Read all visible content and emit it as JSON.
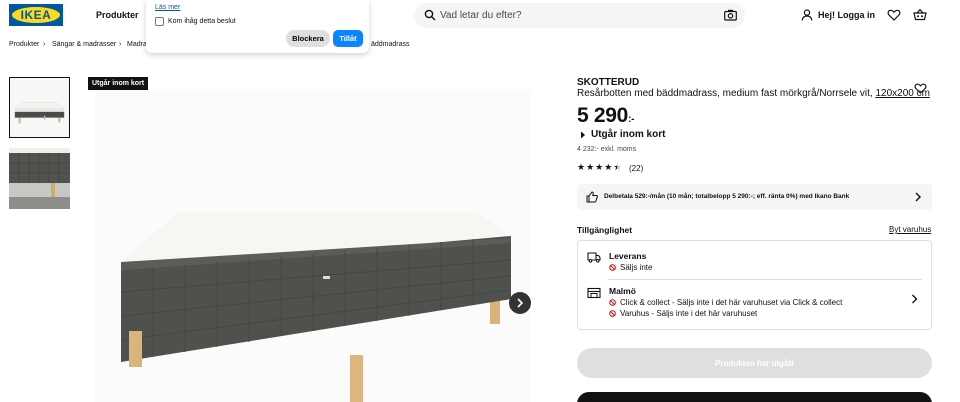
{
  "header": {
    "logo": "IKEA",
    "nav_products": "Produkter",
    "search_placeholder": "Vad letar du efter?",
    "login": "Hej! Logga in",
    "icons": [
      "search-icon",
      "camera-icon",
      "user-icon",
      "heart-icon",
      "cart-icon"
    ]
  },
  "cookie_popup": {
    "read_more": "Läs mer",
    "remember": "Kom ihåg detta beslut",
    "block": "Blockera",
    "allow": "Tillåt"
  },
  "breadcrumb": [
    "Produkter",
    "Sängar & madrasser",
    "Madra",
    "äddmadrass"
  ],
  "badge": "Utgår inom kort",
  "product": {
    "name": "SKOTTERUD",
    "description": "Resårbotten med bäddmadrass, medium fast mörkgrå/Norrsele vit, ",
    "size": "120x200 cm",
    "price": "5 290",
    "price_suffix": ":-",
    "status": "Utgår inom kort",
    "vat_note": "4 232:- exkl. moms",
    "rating": 4.5,
    "review_count": "(22)"
  },
  "finance": {
    "text": "Delbetala 529:-/mån (10 mån; totalbelopp 5 290:-; eff. ränta 0%) med Ikano Bank"
  },
  "availability": {
    "title": "Tillgänglighet",
    "change_store": "Byt varuhus",
    "delivery_title": "Leverans",
    "delivery_status": "Säljs inte",
    "store_title": "Malmö",
    "store_line1": "Click & collect - Säljs inte i det här varuhuset via Click & collect",
    "store_line2": "Varuhus - Säljs inte i det här varuhuset"
  },
  "buttons": {
    "discontinued": "Produkten har utgått"
  },
  "colors": {
    "ikea_blue": "#0058a3",
    "ikea_yellow": "#ffda1a",
    "allow_blue": "#0a84ff",
    "unavailable_red": "#cc0008"
  }
}
